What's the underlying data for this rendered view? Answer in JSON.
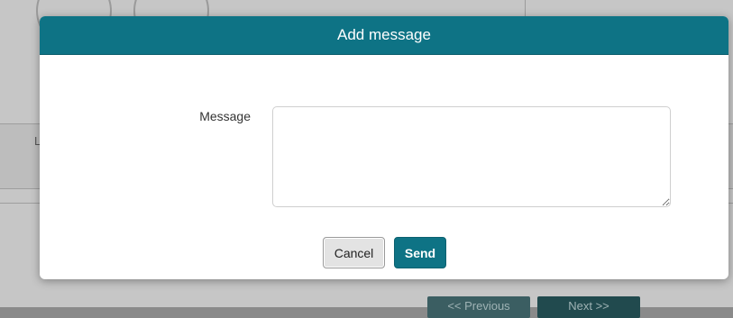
{
  "modal": {
    "title": "Add message",
    "form": {
      "message_label": "Message",
      "message_value": "",
      "message_placeholder": ""
    },
    "buttons": {
      "cancel_label": "Cancel",
      "send_label": "Send"
    }
  },
  "background": {
    "row_text": "L",
    "previous_label": "<< Previous",
    "next_label": "Next >>"
  },
  "colors": {
    "accent": "#0e7385",
    "overlay": "#8a8a8a",
    "dialog_bg": "#ffffff"
  }
}
